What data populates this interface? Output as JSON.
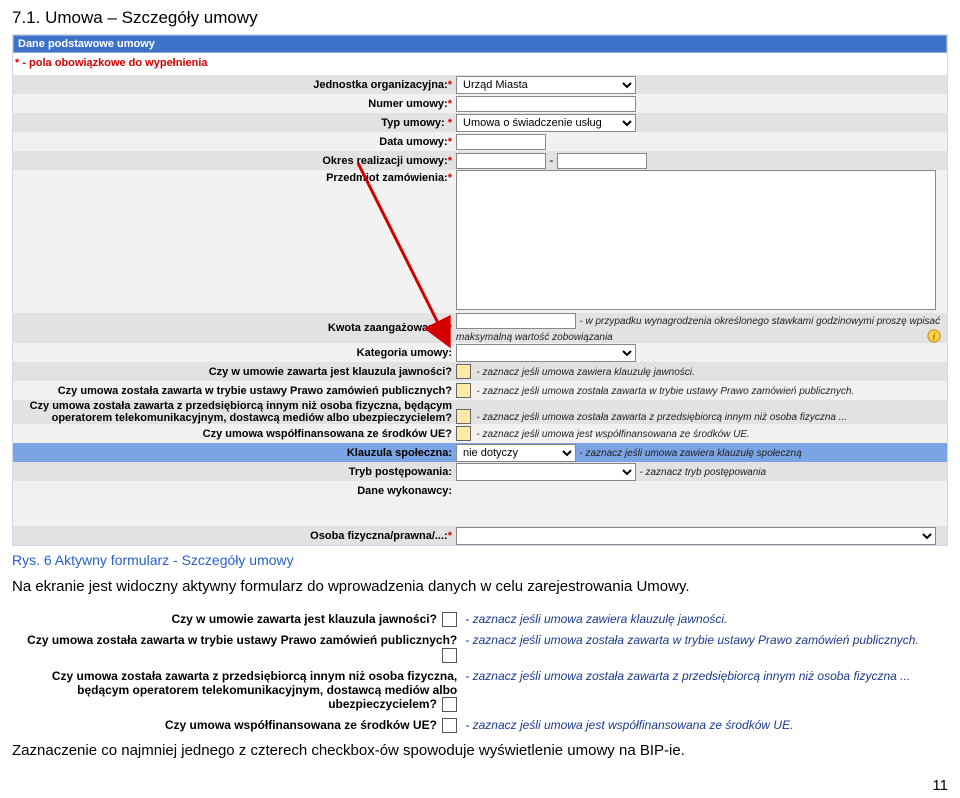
{
  "heading": "7.1. Umowa – Szczegóły umowy",
  "section_header": "Dane podstawowe umowy",
  "required_note": "* - pola obowiązkowe do wypełnienia",
  "fields": {
    "jednostka": {
      "label": "Jednostka organizacyjna:",
      "value": "Urząd Miasta"
    },
    "numer": {
      "label": "Numer umowy:"
    },
    "typ": {
      "label": "Typ umowy:",
      "value": "Umowa o świadczenie usług"
    },
    "data": {
      "label": "Data umowy:"
    },
    "okres": {
      "label": "Okres realizacji umowy:",
      "sep": "-"
    },
    "przedmiot": {
      "label": "Przedmiot zamówienia:"
    },
    "kwota": {
      "label": "Kwota zaangażowania:",
      "hint": "- w przypadku wynagrodzenia określonego stawkami godzinowymi proszę wpisać maksymalną wartość zobowiązania"
    },
    "kategoria": {
      "label": "Kategoria umowy:"
    },
    "klauzula_jawnosci": {
      "label": "Czy w umowie zawarta jest klauzula jawności?",
      "hint": "- zaznacz jeśli umowa zawiera klauzulę jawności."
    },
    "tryb_ustawy": {
      "label": "Czy umowa została zawarta w trybie ustawy Prawo zamówień publicznych?",
      "hint": "- zaznacz jeśli umowa została zawarta w trybie ustawy Prawo zamówień publicznych."
    },
    "przedsiebiorca": {
      "label": "Czy umowa została zawarta z przedsiębiorcą innym niż osoba fizyczna, będącym operatorem telekomunikacyjnym, dostawcą mediów albo ubezpieczycielem?",
      "hint": "- zaznacz jeśli umowa została zawarta z przedsiębiorcą innym niż osoba fizyczna ..."
    },
    "wspolfinansowana": {
      "label": "Czy umowa współfinansowana ze środków UE?",
      "hint": "- zaznacz jeśli umowa jest współfinansowana ze środków UE."
    },
    "klauzula_spoleczna": {
      "label": "Klauzula społeczna:",
      "value": "nie dotyczy",
      "hint": "- zaznacz jeśli umowa zawiera klauzulę społeczną"
    },
    "tryb_post": {
      "label": "Tryb postępowania:",
      "hint": "- zaznacz tryb postępowania"
    },
    "dane_wykonawcy": {
      "label": "Dane wykonawcy:"
    },
    "osoba": {
      "label": "Osoba fizyczna/prawna/...:"
    }
  },
  "caption": "Rys. 6 Aktywny formularz - Szczegóły umowy",
  "body_text": "Na ekranie jest widoczny aktywny formularz do wprowadzenia danych w celu zarejestrowania Umowy.",
  "explain": [
    {
      "label": "Czy w umowie zawarta jest klauzula jawności?",
      "hint": "- zaznacz jeśli umowa zawiera klauzulę jawności."
    },
    {
      "label": "Czy umowa została zawarta w trybie ustawy Prawo zamówień publicznych?",
      "hint": "- zaznacz jeśli umowa została zawarta w trybie ustawy Prawo zamówień publicznych."
    },
    {
      "label": "Czy umowa została zawarta z przedsiębiorcą innym niż osoba fizyczna, będącym operatorem telekomunikacyjnym, dostawcą mediów albo ubezpieczycielem?",
      "hint": "- zaznacz jeśli umowa została zawarta z przedsiębiorcą innym niż osoba fizyczna ..."
    },
    {
      "label": "Czy umowa współfinansowana ze środków UE?",
      "hint": "- zaznacz jeśli umowa jest współfinansowana ze środków UE."
    }
  ],
  "closing_text": "Zaznaczenie co najmniej jednego z czterech checkbox-ów spowoduje wyświetlenie umowy na BIP-ie.",
  "page_number": "11"
}
